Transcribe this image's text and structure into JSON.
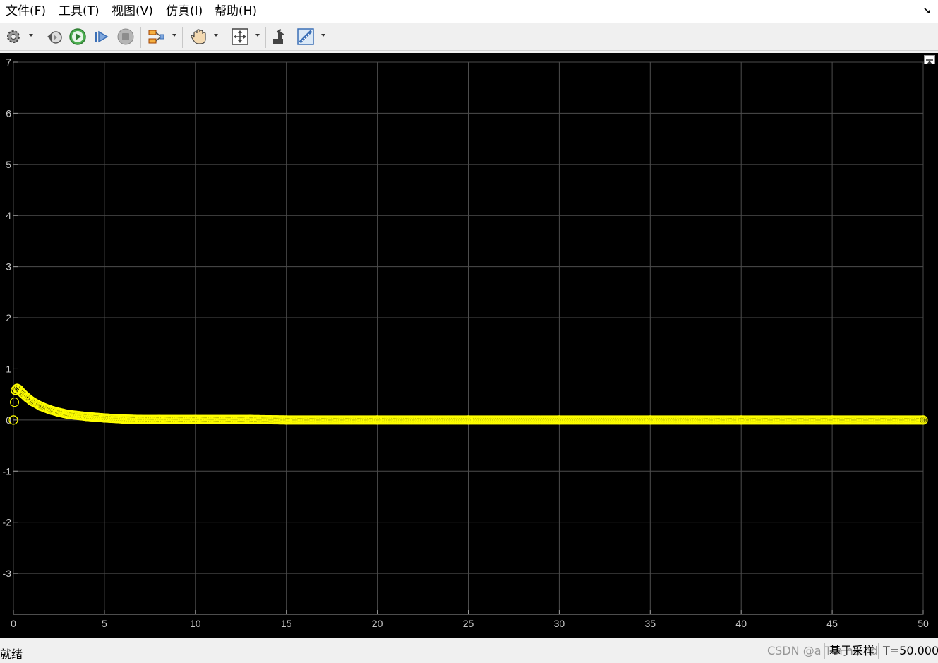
{
  "menu": {
    "items": [
      "文件(F)",
      "工具(T)",
      "视图(V)",
      "仿真(I)",
      "帮助(H)"
    ],
    "undock_icon": "undock-arrow-icon"
  },
  "toolbar": {
    "icons": [
      "settings-icon",
      "step-back-icon",
      "run-icon",
      "step-forward-icon",
      "stop-icon",
      "signal-selector-icon",
      "pan-icon",
      "zoom-fit-icon",
      "highlight-block-icon",
      "measure-icon"
    ]
  },
  "status": {
    "text": "就绪",
    "sample_mode": "基于采样",
    "time": "T=50.000",
    "watermark": "CSDN @a   T    n  ha  nd"
  },
  "colors": {
    "plot_background": "#000000",
    "grid": "#4d4d4d",
    "signal": "#ffff00",
    "tick_label": "#c8c8c8"
  },
  "chart_data": {
    "type": "scatter",
    "title": "",
    "xlabel": "",
    "ylabel": "",
    "xlim": [
      0,
      50
    ],
    "ylim": [
      -3.8,
      7
    ],
    "x_ticks": [
      "0",
      "5",
      "10",
      "15",
      "20",
      "25",
      "30",
      "35",
      "40",
      "45",
      "50"
    ],
    "y_ticks": [
      "-3",
      "-2",
      "-1",
      "0",
      "1",
      "2",
      "3",
      "4",
      "5",
      "6",
      "7"
    ],
    "grid": true,
    "marker": "circle",
    "series": [
      {
        "x": [
          0,
          0.1,
          0.2,
          0.3,
          0.5,
          0.75,
          1.0,
          1.5,
          2.0,
          2.5,
          3.0,
          4.0,
          5.0,
          6.0,
          7.0,
          8.0,
          10.0,
          13.0,
          15.0,
          20.0,
          25.0,
          30.0,
          35.0,
          40.0,
          45.0,
          50.0
        ],
        "y": [
          0.0,
          0.58,
          0.62,
          0.6,
          0.52,
          0.44,
          0.37,
          0.27,
          0.2,
          0.15,
          0.11,
          0.07,
          0.04,
          0.02,
          0.01,
          0.01,
          0.01,
          0.01,
          0.0,
          0.0,
          0.0,
          0.0,
          0.0,
          0.0,
          0.0,
          0.0
        ]
      }
    ]
  }
}
